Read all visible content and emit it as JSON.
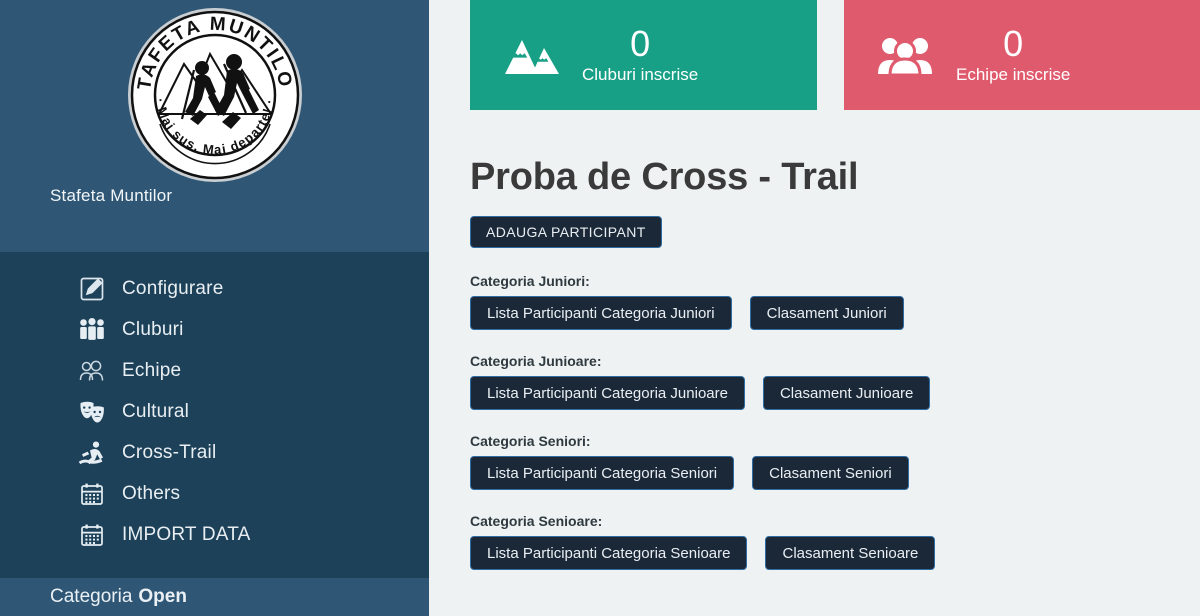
{
  "sidebar": {
    "logo": {
      "icon": "stafeta-muntilor-logo",
      "top_text": "STAFETA MUNTILOR",
      "bottom_text": "Mai sus, Mai departe!"
    },
    "brand_name": "Stafeta Muntilor",
    "items": [
      {
        "label": "Configurare",
        "icon": "edit-square-icon"
      },
      {
        "label": "Cluburi",
        "icon": "group-people-icon"
      },
      {
        "label": "Echipe",
        "icon": "two-people-outline-icon"
      },
      {
        "label": "Cultural",
        "icon": "theater-masks-icon"
      },
      {
        "label": "Cross-Trail",
        "icon": "running-trail-icon"
      },
      {
        "label": "Others",
        "icon": "calendar-icon"
      },
      {
        "label": "IMPORT DATA",
        "icon": "calendar-icon"
      }
    ],
    "footer": {
      "prefix": "Categoria",
      "value": "Open"
    }
  },
  "stats": [
    {
      "value": "0",
      "caption": "Cluburi inscrise",
      "icon": "mountains-icon",
      "color": "#17a085"
    },
    {
      "value": "0",
      "caption": "Echipe inscrise",
      "icon": "people-group-icon",
      "color": "#e05a6e"
    }
  ],
  "main": {
    "title": "Proba de Cross - Trail",
    "add_button": "ADAUGA PARTICIPANT",
    "categories": [
      {
        "label": "Categoria Juniori:",
        "list_button": "Lista Participanti Categoria Juniori",
        "rank_button": "Clasament Juniori"
      },
      {
        "label": "Categoria Junioare:",
        "list_button": "Lista Participanti Categoria Junioare",
        "rank_button": "Clasament Junioare"
      },
      {
        "label": "Categoria Seniori:",
        "list_button": "Lista Participanti Categoria Seniori",
        "rank_button": "Clasament Seniori"
      },
      {
        "label": "Categoria Senioare:",
        "list_button": "Lista Participanti Categoria Senioare",
        "rank_button": "Clasament Senioare"
      }
    ]
  },
  "colors": {
    "sidebar_header": "#2f5775",
    "sidebar_nav": "#1d4159",
    "page_background": "#eef2f2",
    "button_dark": "#1b2838",
    "button_border": "#2e6da4",
    "accent_green": "#17a085",
    "accent_red": "#e05a6e"
  }
}
